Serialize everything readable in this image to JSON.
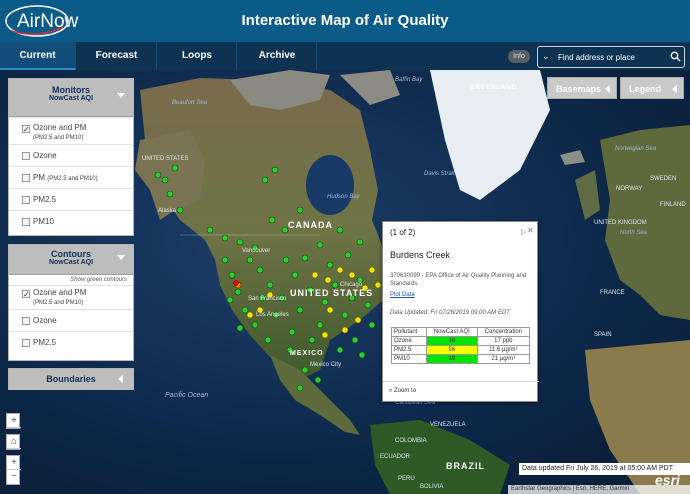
{
  "app": {
    "logo_text": "AirNow",
    "title": "Interactive Map of Air Quality"
  },
  "nav": {
    "tabs": [
      {
        "label": "Current",
        "active": true
      },
      {
        "label": "Forecast",
        "active": false
      },
      {
        "label": "Loops",
        "active": false
      },
      {
        "label": "Archive",
        "active": false
      }
    ],
    "info_label": "Info",
    "search_placeholder": "Find address or place"
  },
  "monitors_panel": {
    "title": "Monitors",
    "subtitle": "NowCast AQI",
    "options": [
      {
        "label": "Ozone and PM",
        "sublabel": "(PM2.5 and PM10)",
        "checked": true
      },
      {
        "label": "Ozone",
        "sublabel": "",
        "checked": false
      },
      {
        "label": "PM",
        "sublabel": "(PM2.5 and PM10)",
        "checked": false
      },
      {
        "label": "PM2.5",
        "sublabel": "",
        "checked": false
      },
      {
        "label": "PM10",
        "sublabel": "",
        "checked": false
      }
    ]
  },
  "contours_panel": {
    "title": "Contours",
    "subtitle": "NowCast AQI",
    "helper": "Show green contours",
    "options": [
      {
        "label": "Ozone and PM",
        "sublabel": "(PM2.5 and PM10)",
        "checked": true
      },
      {
        "label": "Ozone",
        "sublabel": "",
        "checked": false
      },
      {
        "label": "PM2.5",
        "sublabel": "",
        "checked": false
      }
    ]
  },
  "boundaries_panel": {
    "title": "Boundaries"
  },
  "map_buttons": {
    "basemaps": "Basemaps",
    "legend": "Legend"
  },
  "map_labels": {
    "greenland": "GREENLAND",
    "canada": "CANADA",
    "united_states": "UNITED STATES",
    "mexico": "MEXICO",
    "brazil": "BRAZIL",
    "sweden": "SWEDEN",
    "finland": "FINLAND",
    "norway": "NORWAY",
    "united_kingdom": "UNITED KINGDOM",
    "france": "FRANCE",
    "spain": "SPAIN",
    "colombia": "COLOMBIA",
    "peru": "PERU",
    "venezuela": "VENEZUELA",
    "ecuador": "ECUADOR",
    "bolivia": "BOLIVIA",
    "hudson_bay": "Hudson Bay",
    "beaufort_sea": "Beaufort Sea",
    "baffin_bay": "Baffin Bay",
    "davis_strait": "Davis Strait",
    "norwegian_sea": "Norwegian Sea",
    "north_sea": "North Sea",
    "pacific_ocean": "Pacific Ocean",
    "caribbean_sea": "Caribbean Sea",
    "alaska": "Alaska",
    "vancouver": "Vancouver",
    "san_francisco": "San Francisco",
    "los_angeles": "Los Angeles",
    "chicago": "Chicago",
    "mexico_city": "Mexico City"
  },
  "popup": {
    "count": "(1 of 2)",
    "site_name": "Burdens Creek",
    "agency": "370630099 - EPA Office of Air Quality Planning and Standards",
    "plot_link": "Plot Data",
    "updated": "Data Updated: Fri 07/26/2019 09:00 AM EDT",
    "table_headers": [
      "Pollutant",
      "NowCast AQI",
      "Concentration"
    ],
    "rows": [
      {
        "pollutant": "Ozone",
        "aqi": "16",
        "concentration": "17 ppb",
        "color": "#00e400"
      },
      {
        "pollutant": "PM2.5",
        "aqi": "56",
        "concentration": "11.6 µg/m³",
        "color": "#ffff00"
      },
      {
        "pollutant": "PM10",
        "aqi": "19",
        "concentration": "21 µg/m³",
        "color": "#00e400"
      }
    ],
    "zoom_label": "Zoom to"
  },
  "footer": {
    "data_updated": "Data updated Fri July 26, 2019 at 05:00 AM PDT",
    "attribution": "Earthstar Geographics | Esri, HERE, Garmin",
    "esri_logo": "esri"
  },
  "colors": {
    "header": "#0a5a8a",
    "nav": "#0e3352",
    "aqi_good": "#00e400",
    "aqi_moderate": "#ffff00",
    "aqi_usg": "#ff7e00",
    "aqi_unhealthy": "#ff0000"
  }
}
